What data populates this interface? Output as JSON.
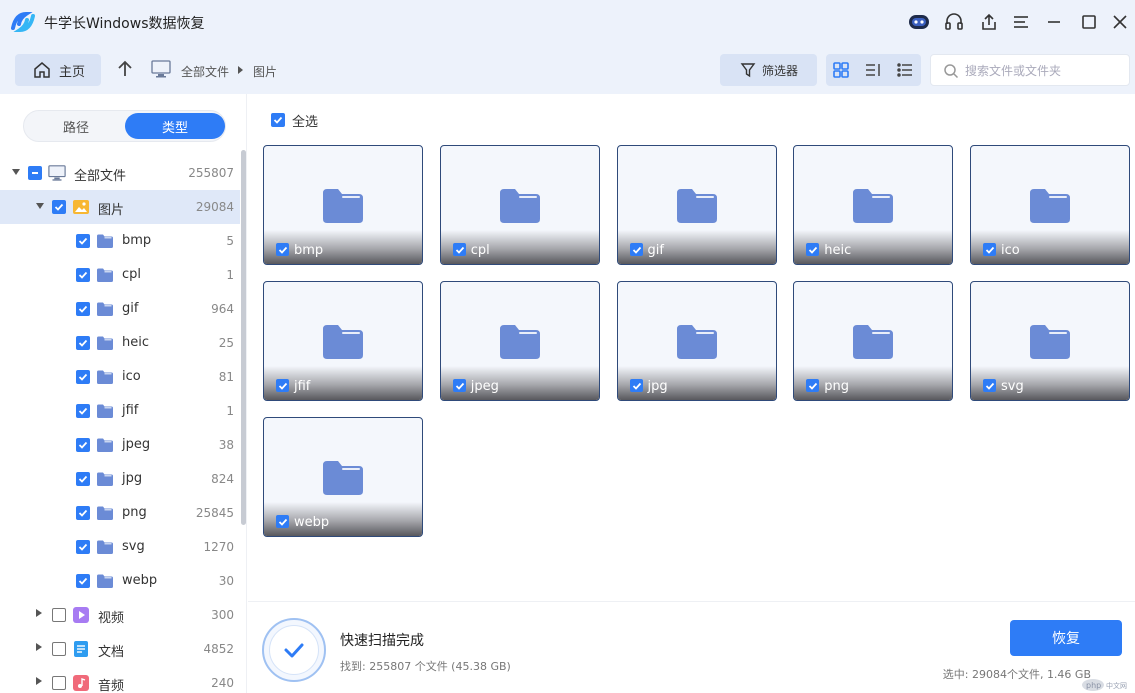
{
  "app": {
    "title": "牛学长Windows数据恢复"
  },
  "toolbar": {
    "home_label": "主页",
    "breadcrumb": [
      "全部文件",
      "图片"
    ],
    "filter_label": "筛选器",
    "search_placeholder": "搜索文件或文件夹"
  },
  "sidebar": {
    "tabs": [
      {
        "label": "路径",
        "active": false
      },
      {
        "label": "类型",
        "active": true
      }
    ],
    "tree": [
      {
        "label": "全部文件",
        "count": "255807",
        "level": 0,
        "expanded": true,
        "check": "partial",
        "icon": "computer-icon"
      },
      {
        "label": "图片",
        "count": "29084",
        "level": 1,
        "expanded": true,
        "check": "on",
        "icon": "image-folder-icon",
        "selected": true
      },
      {
        "label": "bmp",
        "count": "5",
        "level": 2,
        "check": "on",
        "icon": "folder-icon"
      },
      {
        "label": "cpl",
        "count": "1",
        "level": 2,
        "check": "on",
        "icon": "folder-icon"
      },
      {
        "label": "gif",
        "count": "964",
        "level": 2,
        "check": "on",
        "icon": "folder-icon"
      },
      {
        "label": "heic",
        "count": "25",
        "level": 2,
        "check": "on",
        "icon": "folder-icon"
      },
      {
        "label": "ico",
        "count": "81",
        "level": 2,
        "check": "on",
        "icon": "folder-icon"
      },
      {
        "label": "jfif",
        "count": "1",
        "level": 2,
        "check": "on",
        "icon": "folder-icon"
      },
      {
        "label": "jpeg",
        "count": "38",
        "level": 2,
        "check": "on",
        "icon": "folder-icon"
      },
      {
        "label": "jpg",
        "count": "824",
        "level": 2,
        "check": "on",
        "icon": "folder-icon"
      },
      {
        "label": "png",
        "count": "25845",
        "level": 2,
        "check": "on",
        "icon": "folder-icon"
      },
      {
        "label": "svg",
        "count": "1270",
        "level": 2,
        "check": "on",
        "icon": "folder-icon"
      },
      {
        "label": "webp",
        "count": "30",
        "level": 2,
        "check": "on",
        "icon": "folder-icon"
      },
      {
        "label": "视频",
        "count": "300",
        "level": 1,
        "expanded": false,
        "check": "off",
        "icon": "video-icon"
      },
      {
        "label": "文档",
        "count": "4852",
        "level": 1,
        "expanded": false,
        "check": "off",
        "icon": "document-icon"
      },
      {
        "label": "音频",
        "count": "240",
        "level": 1,
        "expanded": false,
        "check": "off",
        "icon": "audio-icon"
      }
    ]
  },
  "main": {
    "select_all_label": "全选",
    "folders": [
      "bmp",
      "cpl",
      "gif",
      "heic",
      "ico",
      "jfif",
      "jpeg",
      "jpg",
      "png",
      "svg",
      "webp"
    ]
  },
  "status": {
    "title": "快速扫描完成",
    "found": "找到: 255807 个文件 (45.38 GB)",
    "recover_label": "恢复",
    "selected": "选中: 29084个文件, 1.46 GB"
  },
  "colors": {
    "accent": "#2e7cf6",
    "folder": "#6b8bd6",
    "titlebar_bg": "#edf2fb"
  }
}
